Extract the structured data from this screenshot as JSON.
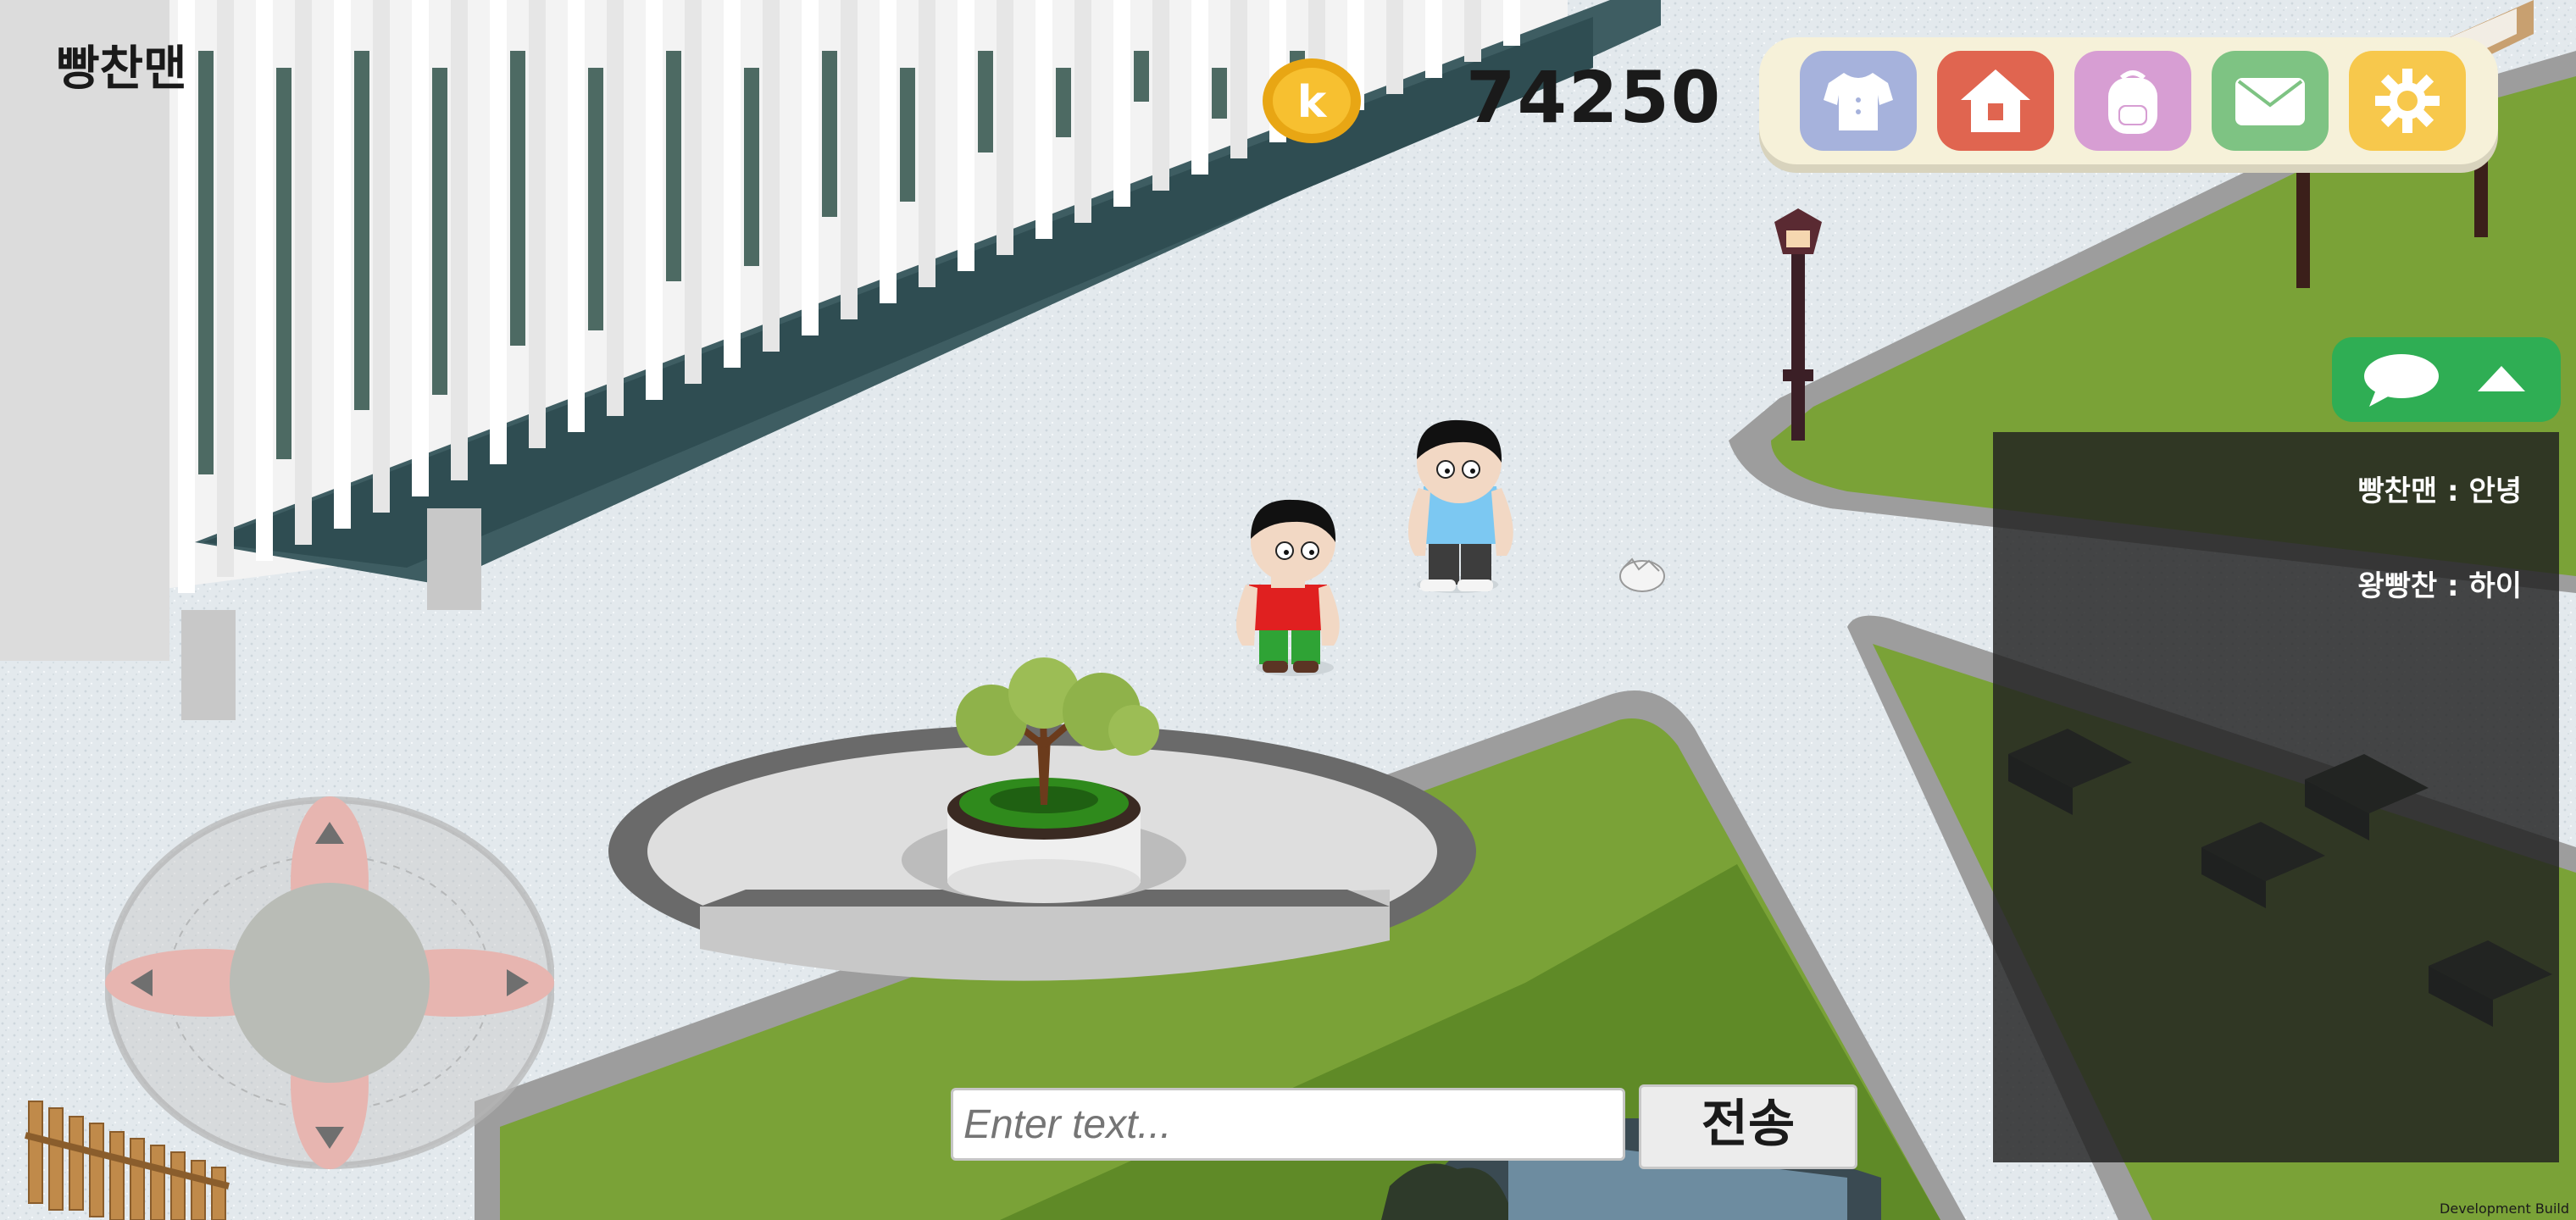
{
  "hud": {
    "player_name": "빵찬맨",
    "coin_symbol": "k",
    "coin_amount": "74250"
  },
  "menu": {
    "buttons": [
      {
        "name": "wardrobe",
        "icon": "shirt-icon",
        "color": "#a6b2dc"
      },
      {
        "name": "home",
        "icon": "house-icon",
        "color": "#e06550"
      },
      {
        "name": "bag",
        "icon": "backpack-icon",
        "color": "#d79ed3"
      },
      {
        "name": "mail",
        "icon": "envelope-icon",
        "color": "#7ec383"
      },
      {
        "name": "settings",
        "icon": "gear-icon",
        "color": "#f7c84c"
      }
    ]
  },
  "chat": {
    "toggle_icon": "speech-bubble-icon",
    "toggle_arrow": "caret-up-icon",
    "messages": [
      {
        "text": "빵찬맨 : 안녕"
      },
      {
        "text": "왕빵찬 : 하이"
      }
    ],
    "input_placeholder": "Enter text...",
    "send_label": "전송"
  },
  "joystick": {
    "icons": [
      "arrow-up-icon",
      "arrow-down-icon",
      "arrow-left-icon",
      "arrow-right-icon"
    ]
  },
  "footer": {
    "build_label": "Development Build"
  },
  "colors": {
    "grass": "#7aa237",
    "pavement": "#dfe6ea",
    "building": "#f4f4f4",
    "chat_green": "#2fae54"
  }
}
